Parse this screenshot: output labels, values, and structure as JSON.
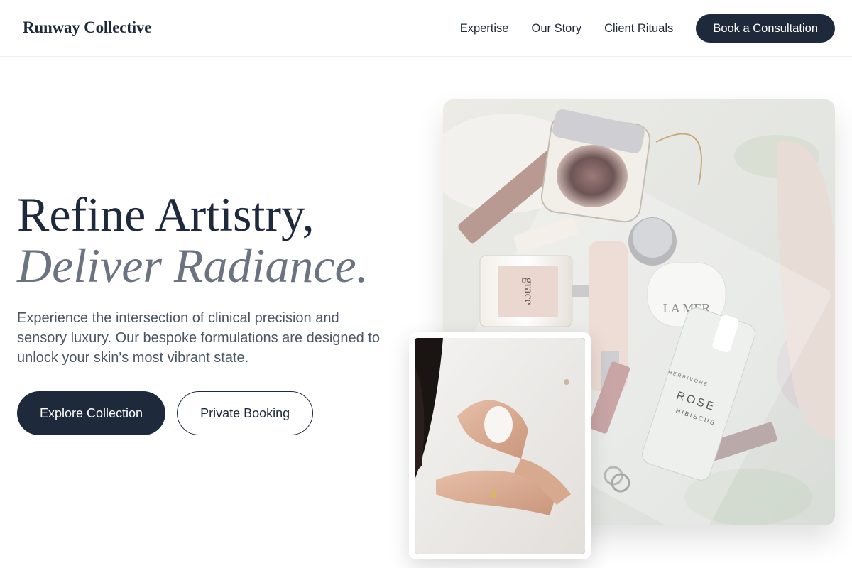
{
  "header": {
    "brand": "Runway Collective",
    "nav": [
      "Expertise",
      "Our Story",
      "Client Rituals"
    ],
    "cta": "Book a Consultation"
  },
  "hero": {
    "title_line1": "Refine Artistry,",
    "title_line2": "Deliver Radiance.",
    "description": "Experience the intersection of clinical precision and sensory luxury. Our bespoke formulations are designed to unlock your skin's most vibrant state.",
    "primary_button": "Explore Collection",
    "secondary_button": "Private Booking"
  },
  "images": {
    "main_icon": "cosmetics-flatlay-photo",
    "inset_icon": "hands-applying-cream-photo",
    "product_labels": {
      "compact": "",
      "grace": "grace",
      "lamer": "LA MER",
      "rose": "ROSE",
      "rose_sub": "HIBISCUS",
      "herbivore": "HERBIVORE"
    }
  },
  "colors": {
    "primary": "#1e293b",
    "muted_heading": "#6b7280",
    "body_text": "#4b5563"
  }
}
